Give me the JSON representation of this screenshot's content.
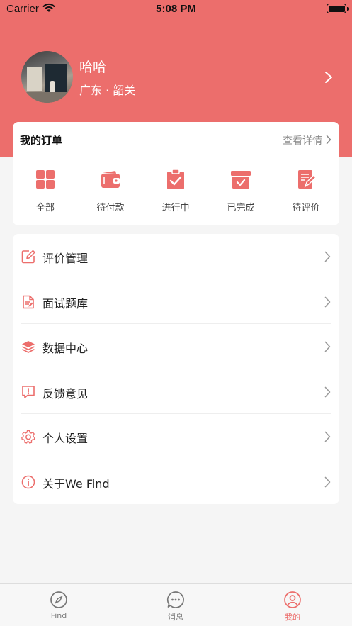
{
  "status_bar": {
    "carrier": "Carrier",
    "time": "5:08 PM"
  },
  "profile": {
    "name": "哈哈",
    "location": "广东 · 韶关"
  },
  "orders": {
    "title": "我的订单",
    "more_label": "查看详情",
    "items": [
      {
        "label": "全部",
        "icon": "grid-icon"
      },
      {
        "label": "待付款",
        "icon": "wallet-icon"
      },
      {
        "label": "进行中",
        "icon": "clipboard-check-icon"
      },
      {
        "label": "已完成",
        "icon": "archive-check-icon"
      },
      {
        "label": "待评价",
        "icon": "edit-doc-icon"
      }
    ]
  },
  "menu": [
    {
      "label": "评价管理",
      "icon": "edit-icon"
    },
    {
      "label": "面试题库",
      "icon": "document-icon"
    },
    {
      "label": "数据中心",
      "icon": "layers-icon"
    },
    {
      "label": "反馈意见",
      "icon": "feedback-icon"
    },
    {
      "label": "个人设置",
      "icon": "gear-icon"
    },
    {
      "label": "关于We Find",
      "icon": "info-icon"
    }
  ],
  "tabbar": [
    {
      "label": "Find",
      "icon": "compass-icon",
      "active": false
    },
    {
      "label": "消息",
      "icon": "message-icon",
      "active": false
    },
    {
      "label": "我的",
      "icon": "user-icon",
      "active": true
    }
  ],
  "colors": {
    "accent": "#ec6e6c",
    "background": "#f5f5f5"
  }
}
